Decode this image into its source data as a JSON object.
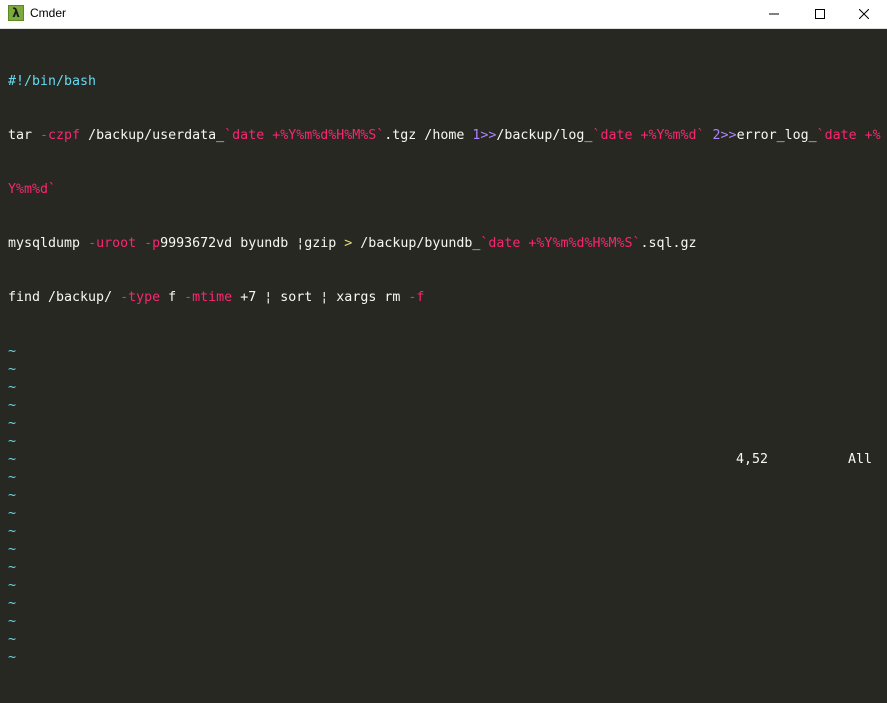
{
  "window": {
    "title": "Cmder",
    "icon": "lambda-icon",
    "icon_glyph": "λ",
    "controls": [
      "minimize-icon",
      "maximize-icon",
      "close-icon"
    ]
  },
  "editor": {
    "line1": {
      "shebang": "#!/bin/bash"
    },
    "line2": {
      "cmd": "tar ",
      "flag": "-czpf",
      "path1": " /backup/userdata_",
      "sub1": "`date +%Y%m%d%H%M%S`",
      "ext": ".tgz /home ",
      "fd1": "1>>",
      "path2": "/backup/log_",
      "sub2": "`date +%Y%m%d`",
      "sp": " ",
      "fd2": "2>>",
      "path3": "error_log_",
      "sub3a": "`date +%",
      "sub3b": "Y%m%d`"
    },
    "line3": {
      "cmd": "mysqldump ",
      "flag1": "-uroot",
      "sp": " ",
      "flag2": "-p",
      "pass": "9993672vd byundb ",
      "pipe": "¦",
      "gzip": "gzip ",
      "redir": ">",
      "path": " /backup/byundb_",
      "sub": "`date +%Y%m%d%H%M%S`",
      "ext": ".sql.gz"
    },
    "line4": {
      "cmd": "find /backup/ ",
      "flag1": "-type",
      "f": " f ",
      "flag2": "-mtime",
      "val": " +7 ",
      "pipe1": "¦",
      "sort": " sort ",
      "pipe2": "¦",
      "xargs": " xargs rm ",
      "flag3": "-f"
    },
    "empty_line_marker": "~",
    "empty_line_count": 18
  },
  "status": {
    "cursor_position": "4,52",
    "scroll_position": "All"
  },
  "colors": {
    "background": "#272822",
    "foreground": "#f8f8f2",
    "keyword_red": "#f92672",
    "comment_blue": "#66d9ef",
    "operator_yellow": "#e6db74"
  }
}
